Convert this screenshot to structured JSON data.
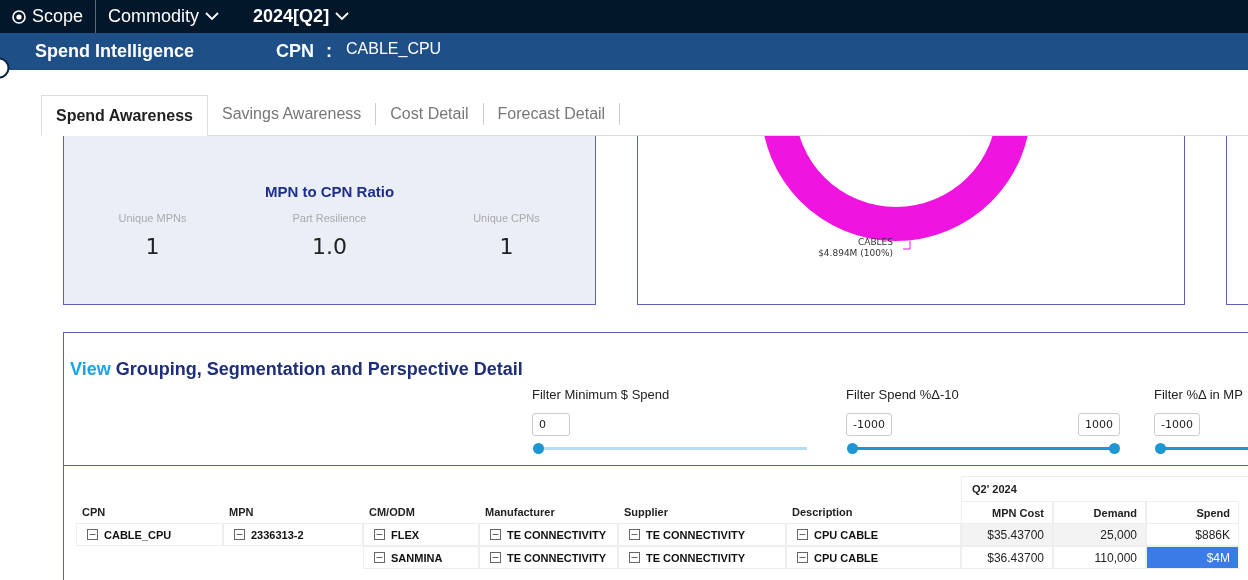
{
  "top_bar": {
    "scope": "Scope",
    "commodity": "Commodity",
    "period": "2024[Q2]"
  },
  "header": {
    "title": "Spend Intelligence",
    "cpn_label": "CPN",
    "separator": ":",
    "cpn_value": "CABLE_CPU"
  },
  "tabs": [
    {
      "label": "Spend Awareness",
      "selected": true
    },
    {
      "label": "Savings Awareness",
      "selected": false
    },
    {
      "label": "Cost Detail",
      "selected": false
    },
    {
      "label": "Forecast Detail",
      "selected": false
    }
  ],
  "ratio_card": {
    "title": "MPN to CPN Ratio",
    "metrics": [
      {
        "label": "Unique MPNs",
        "value": "1"
      },
      {
        "label": "Part Resilience",
        "value": "1.0"
      },
      {
        "label": "Unique CPNs",
        "value": "1"
      }
    ]
  },
  "spend_chart": {
    "slices": [
      {
        "label": "CABLES",
        "value": "$4.894M (100%)"
      }
    ]
  },
  "detail": {
    "title_accent": "View",
    "title": "Grouping, Segmentation and Perspective Detail",
    "filters": [
      {
        "kind": "single",
        "label": "Filter Minimum $ Spend",
        "min": "0",
        "level": 0
      },
      {
        "kind": "range",
        "label": "Filter Spend %Δ-10",
        "min": "-1000",
        "max": "1000",
        "level": 1
      },
      {
        "kind": "partial",
        "label": "Filter %Δ in MP",
        "min": "-1000"
      }
    ]
  },
  "table": {
    "group_header": "Q2' 2024",
    "columns": [
      "CPN",
      "MPN",
      "CM/ODM",
      "Manufacturer",
      "Supplier",
      "Description",
      "MPN Cost",
      "Demand",
      "Spend"
    ],
    "groups": [
      {
        "cpn": "CABLE_CPU",
        "mpn": "2336313-2",
        "rows": [
          {
            "cm": "FLEX",
            "manufacturer": "TE CONNECTIVITY",
            "supplier": "TE CONNECTIVITY",
            "description": "CPU CABLE",
            "mpn_cost": "$35.43700",
            "demand": "25,000",
            "spend": "$886K",
            "shaded": true,
            "highlighted": false
          },
          {
            "cm": "SANMINA",
            "manufacturer": "TE CONNECTIVITY",
            "supplier": "TE CONNECTIVITY",
            "description": "CPU CABLE",
            "mpn_cost": "$36.43700",
            "demand": "110,000",
            "spend": "$4M",
            "shaded": false,
            "highlighted": true
          }
        ]
      }
    ]
  }
}
